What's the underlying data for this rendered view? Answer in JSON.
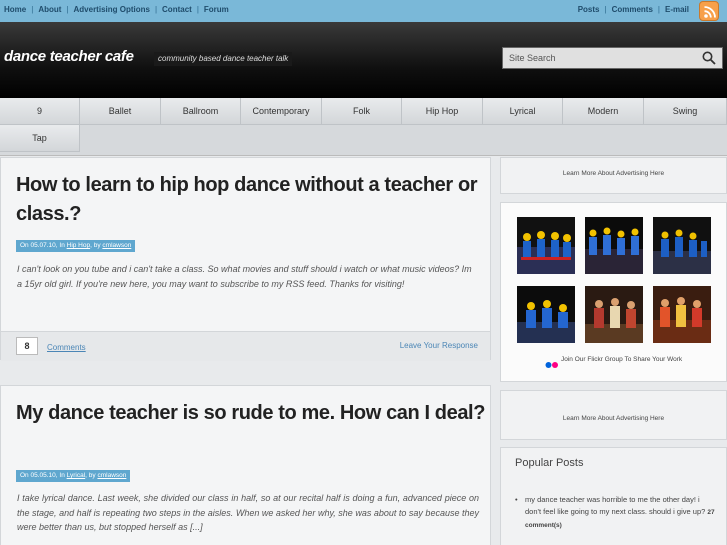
{
  "topbar": {
    "left_links": [
      "Home",
      "About",
      "Advertising Options",
      "Contact",
      "Forum"
    ],
    "right_links": [
      "Posts",
      "Comments",
      "E-mail"
    ],
    "rss_icon": "rss-icon"
  },
  "header": {
    "logo": "dance teacher cafe",
    "tagline": "community based dance teacher talk",
    "search_placeholder": "Site Search",
    "search_icon": "search-icon"
  },
  "nav": {
    "items": [
      "9",
      "Ballet",
      "Ballroom",
      "Contemporary",
      "Folk",
      "Hip Hop",
      "Lyrical",
      "Modern",
      "Swing",
      "Tap"
    ]
  },
  "posts": [
    {
      "title": "How to learn to hip hop dance without a teacher or class.?",
      "meta_prefix": "On 05.07.10, In ",
      "category": "Hip Hop",
      "meta_by": ", by ",
      "author": "cmlawson",
      "excerpt": "I can't look on you tube and i can't take a class. So what movies and stuff should i watch or what music videos? Im a 15yr old girl. If you're new here, you may want to subscribe to my RSS feed. Thanks for visiting!",
      "comment_count": "8",
      "comments_label": "Comments",
      "leave_label": "Leave Your Response"
    },
    {
      "title": "My dance teacher is so rude to me. How can I deal?",
      "meta_prefix": "On 05.05.10, In ",
      "category": "Lyrical",
      "meta_by": ", by ",
      "author": "cmlawson",
      "excerpt": "I take lyrical dance. Last week, she divided our class in half, so at our recital half is doing a fun, advanced piece on the stage, and half is repeating two steps in the aisles. When we asked her why, she was about to say because they were better than us, but stopped herself as [...]"
    }
  ],
  "sidebar": {
    "ad_top": "Learn More About Advertising Here",
    "flickr_note": "Join Our Flickr Group To Share Your Work",
    "ad_bottom": "Learn More About Advertising Here",
    "popular_title": "Popular Posts",
    "popular_items": [
      {
        "text": "my dance teacher was horrible to me the other day! i don't feel like going to my next class. should i give up?",
        "count": "27 comment(s)"
      }
    ]
  },
  "colors": {
    "topbar": "#7ab8d8",
    "accent": "#5fa7cf",
    "link": "#4b86b6",
    "flickr_blue": "#0063dc",
    "flickr_pink": "#ff0084"
  }
}
